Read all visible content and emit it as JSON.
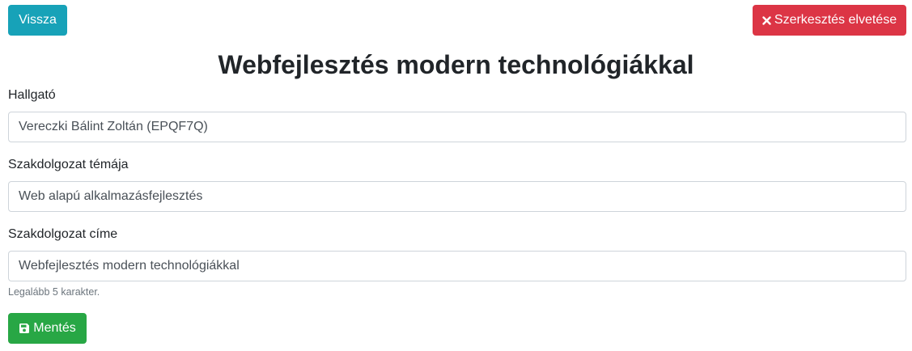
{
  "toolbar": {
    "back_label": "Vissza",
    "cancel_label": "Szerkesztés elvetése",
    "cancel_icon": "close-icon"
  },
  "page": {
    "title": "Webfejlesztés modern technológiákkal"
  },
  "form": {
    "student": {
      "label": "Hallgató",
      "value": "Vereczki Bálint Zoltán (EPQF7Q)"
    },
    "topic": {
      "label": "Szakdolgozat témája",
      "value": "Web alapú alkalmazásfejlesztés"
    },
    "thesis_title": {
      "label": "Szakdolgozat címe",
      "value": "Webfejlesztés modern technológiákkal",
      "help": "Legalább 5 karakter."
    },
    "save_label": "Mentés",
    "save_icon": "floppy-disk-icon"
  },
  "colors": {
    "back": "#17a2b8",
    "cancel": "#dc3545",
    "save": "#28a745"
  }
}
